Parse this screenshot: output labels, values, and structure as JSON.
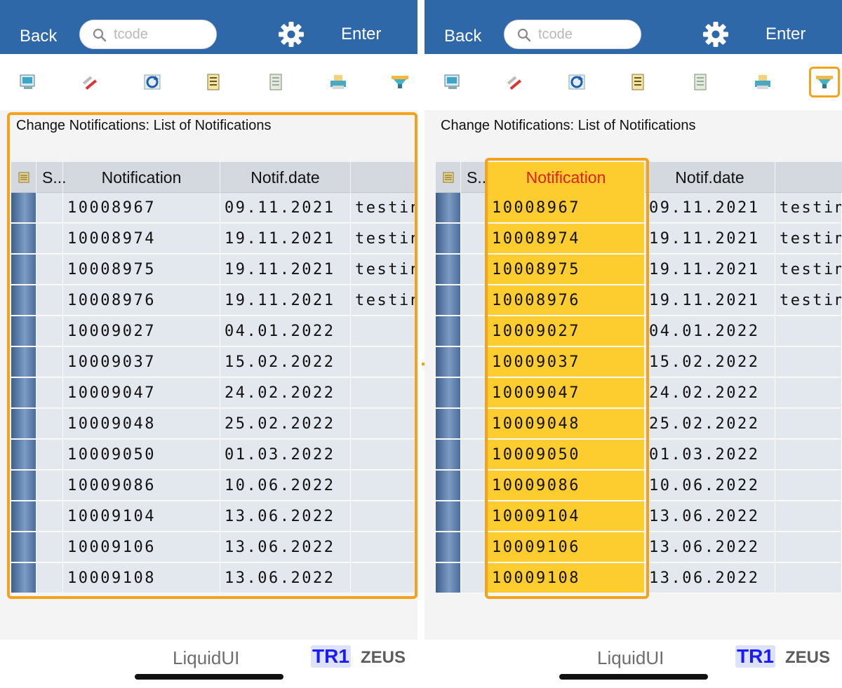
{
  "app": {
    "back_label": "Back",
    "tcode_placeholder": "tcode",
    "enter_label": "Enter",
    "title": "Change Notifications: List of Notifications",
    "brand": "LiquidUI",
    "system": "TR1",
    "server": "ZEUS"
  },
  "toolbar_icons": [
    "display-icon",
    "edit-icon",
    "refresh-icon",
    "details-icon",
    "document-icon",
    "print-icon",
    "filter-icon"
  ],
  "table": {
    "columns": [
      "S...",
      "Notification",
      "Notif.date",
      ""
    ],
    "rows": [
      {
        "notification": "10008967",
        "date": "09.11.2021",
        "description": "testin"
      },
      {
        "notification": "10008974",
        "date": "19.11.2021",
        "description": "testin"
      },
      {
        "notification": "10008975",
        "date": "19.11.2021",
        "description": "testin"
      },
      {
        "notification": "10008976",
        "date": "19.11.2021",
        "description": "testin"
      },
      {
        "notification": "10009027",
        "date": "04.01.2022",
        "description": ""
      },
      {
        "notification": "10009037",
        "date": "15.02.2022",
        "description": ""
      },
      {
        "notification": "10009047",
        "date": "24.02.2022",
        "description": ""
      },
      {
        "notification": "10009048",
        "date": "25.02.2022",
        "description": ""
      },
      {
        "notification": "10009050",
        "date": "01.03.2022",
        "description": ""
      },
      {
        "notification": "10009086",
        "date": "10.06.2022",
        "description": ""
      },
      {
        "notification": "10009104",
        "date": "13.06.2022",
        "description": ""
      },
      {
        "notification": "10009106",
        "date": "13.06.2022",
        "description": ""
      },
      {
        "notification": "10009108",
        "date": "13.06.2022",
        "description": ""
      }
    ]
  },
  "colors": {
    "header_blue": "#2f68a8",
    "highlight_orange": "#f4a21c",
    "selected_column_yellow": "#fdcc2f",
    "selected_header_red": "#e0201b"
  }
}
